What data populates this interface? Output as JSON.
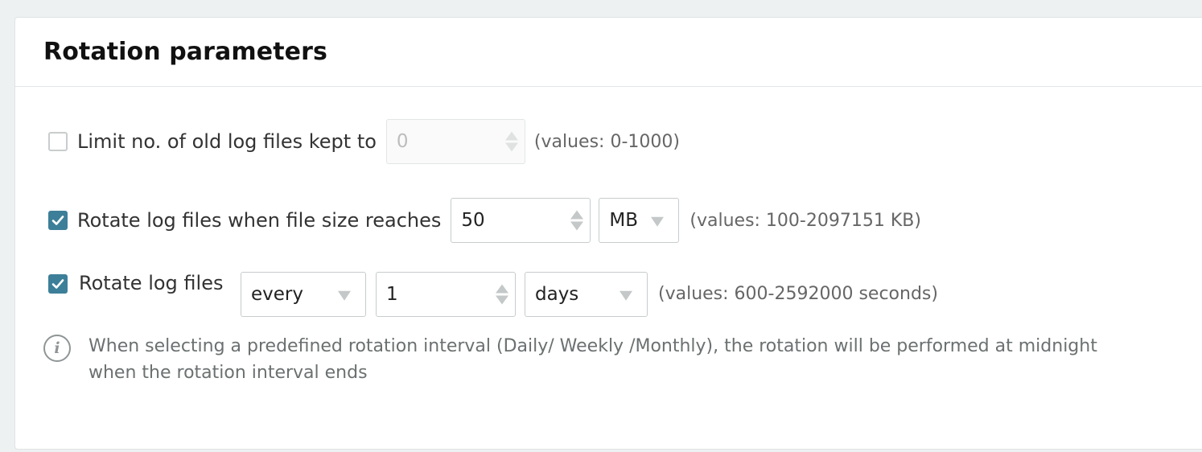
{
  "panel": {
    "title": "Rotation parameters"
  },
  "limit_files": {
    "checked": false,
    "label": "Limit no. of old log files kept to",
    "value": "0",
    "hint": "(values: 0-1000)"
  },
  "size_rotation": {
    "checked": true,
    "label": "Rotate log files when file size reaches",
    "value": "50",
    "unit": "MB",
    "hint": "(values: 100-2097151 KB)"
  },
  "time_rotation": {
    "checked": true,
    "label": "Rotate log files",
    "mode": "every",
    "value": "1",
    "unit": "days",
    "hint": "(values: 600-2592000 seconds)"
  },
  "info": {
    "icon": "info-icon",
    "text": "When selecting a predefined rotation interval (Daily/ Weekly /Monthly), the rotation will be performed at midnight when the rotation interval ends"
  },
  "colors": {
    "checkbox_checked": "#3d7f99",
    "background": "#eef1f1",
    "panel": "#ffffff"
  }
}
